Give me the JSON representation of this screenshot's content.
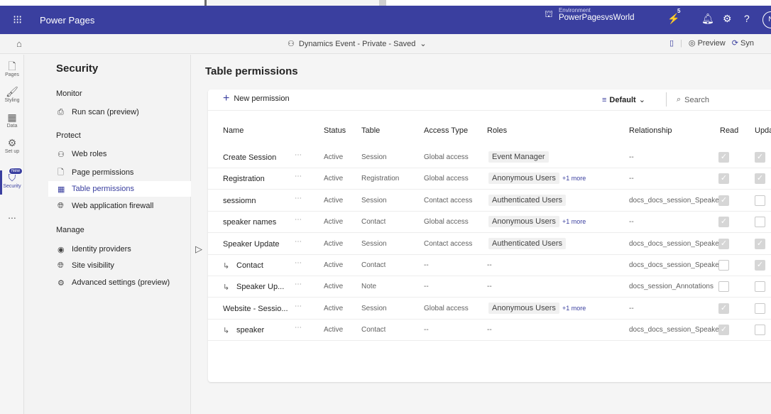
{
  "app": {
    "name": "Power Pages",
    "environment_label": "Environment",
    "environment_name": "PowerPagesvsWorld",
    "notification_count": "5"
  },
  "subbar": {
    "site_title": "Dynamics Event - Private - Saved",
    "preview_label": "Preview",
    "sync_label": "Syn"
  },
  "rail": {
    "items": [
      {
        "label": "Pages"
      },
      {
        "label": "Styling"
      },
      {
        "label": "Data"
      },
      {
        "label": "Set up"
      },
      {
        "label": "Security"
      },
      {
        "label": "..."
      }
    ],
    "new_badge": "New"
  },
  "sidenav": {
    "title": "Security",
    "groups": [
      {
        "label": "Monitor"
      },
      {
        "label": "Protect"
      },
      {
        "label": "Manage"
      }
    ],
    "items": [
      {
        "label": "Run scan (preview)"
      },
      {
        "label": "Web roles"
      },
      {
        "label": "Page permissions"
      },
      {
        "label": "Table permissions"
      },
      {
        "label": "Web application firewall"
      },
      {
        "label": "Identity providers"
      },
      {
        "label": "Site visibility"
      },
      {
        "label": "Advanced settings (preview)"
      }
    ]
  },
  "main": {
    "title": "Table permissions",
    "new_permission_label": "New permission",
    "view_label": "Default",
    "search_placeholder": "Search",
    "columns": {
      "name": "Name",
      "status": "Status",
      "table": "Table",
      "access_type": "Access Type",
      "roles": "Roles",
      "relationship": "Relationship",
      "read": "Read",
      "update": "Upda"
    },
    "rows": [
      {
        "name": "Create Session",
        "child": false,
        "status": "Active",
        "table": "Session",
        "access": "Global access",
        "role": "Event Manager",
        "more": "",
        "relationship": "--",
        "read": true,
        "update": true
      },
      {
        "name": "Registration",
        "child": false,
        "status": "Active",
        "table": "Registration",
        "access": "Global access",
        "role": "Anonymous Users",
        "more": "+1 more",
        "relationship": "--",
        "read": true,
        "update": true
      },
      {
        "name": "sessiomn",
        "child": false,
        "status": "Active",
        "table": "Session",
        "access": "Contact access",
        "role": "Authenticated Users",
        "more": "",
        "relationship": "docs_docs_session_Speaker_con",
        "read": true,
        "update": false
      },
      {
        "name": "speaker names",
        "child": false,
        "status": "Active",
        "table": "Contact",
        "access": "Global access",
        "role": "Anonymous Users",
        "more": "+1 more",
        "relationship": "--",
        "read": true,
        "update": false
      },
      {
        "name": "Speaker Update",
        "child": false,
        "status": "Active",
        "table": "Session",
        "access": "Contact access",
        "role": "Authenticated Users",
        "more": "",
        "relationship": "docs_docs_session_Speaker_con",
        "read": true,
        "update": true
      },
      {
        "name": "Contact",
        "child": true,
        "status": "Active",
        "table": "Contact",
        "access": "--",
        "role": "",
        "roles_text": "--",
        "more": "",
        "relationship": "docs_docs_session_Speaker_con",
        "read": false,
        "update": true
      },
      {
        "name": "Speaker Up...",
        "child": true,
        "status": "Active",
        "table": "Note",
        "access": "--",
        "role": "",
        "roles_text": "--",
        "more": "",
        "relationship": "docs_session_Annotations",
        "read": false,
        "update": false
      },
      {
        "name": "Website - Sessio...",
        "child": false,
        "status": "Active",
        "table": "Session",
        "access": "Global access",
        "role": "Anonymous Users",
        "more": "+1 more",
        "relationship": "--",
        "read": true,
        "update": false
      },
      {
        "name": "speaker",
        "child": true,
        "status": "Active",
        "table": "Contact",
        "access": "--",
        "role": "",
        "roles_text": "--",
        "more": "",
        "relationship": "docs_docs_session_Speaker_con",
        "read": true,
        "update": false
      }
    ]
  }
}
